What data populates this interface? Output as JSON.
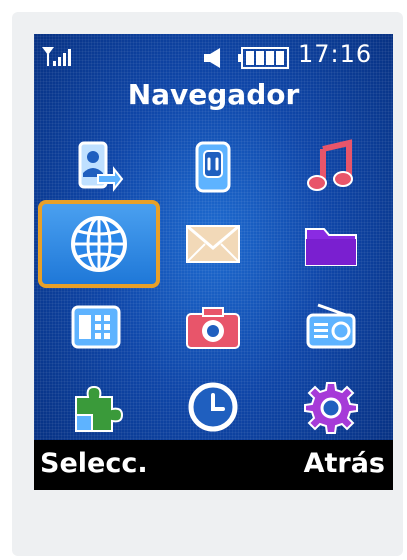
{
  "status": {
    "time": "17:16",
    "signal_icon": "signal-bars-icon",
    "sound_icon": "speaker-icon",
    "battery_icon": "battery-icon"
  },
  "title": "Navegador",
  "menu": {
    "selected_index": 3,
    "items": [
      {
        "icon": "contacts-transfer-icon"
      },
      {
        "icon": "mobile-phone-icon"
      },
      {
        "icon": "music-note-icon"
      },
      {
        "icon": "browser-globe-icon"
      },
      {
        "icon": "messages-envelope-icon"
      },
      {
        "icon": "folder-icon"
      },
      {
        "icon": "calendar-icon"
      },
      {
        "icon": "camera-icon"
      },
      {
        "icon": "radio-icon"
      },
      {
        "icon": "applications-puzzle-icon"
      },
      {
        "icon": "clock-icon"
      },
      {
        "icon": "settings-gear-icon"
      }
    ]
  },
  "softkeys": {
    "left": "Selecc.",
    "right": "Atrás"
  },
  "colors": {
    "screen_blue": "#0f46a8",
    "selection_border": "#e8a028",
    "icon_blue": "#5eb3ff",
    "icon_red": "#e8556a",
    "icon_violet": "#8a2be2"
  }
}
